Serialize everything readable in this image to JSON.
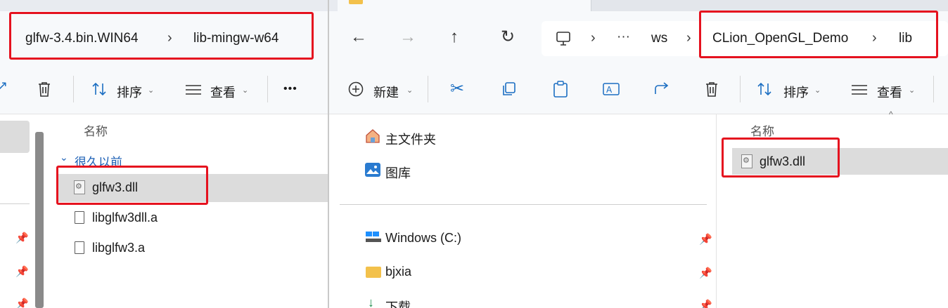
{
  "left": {
    "breadcrumb": [
      "glfw-3.4.bin.WIN64",
      "lib-mingw-w64"
    ],
    "toolbar": {
      "sort": "排序",
      "view": "查看",
      "more": "•••"
    },
    "header_name": "名称",
    "group_label": "很久以前",
    "files": [
      "glfw3.dll",
      "libglfw3dll.a",
      "libglfw3.a"
    ]
  },
  "right": {
    "breadcrumb": [
      "ws",
      "CLion_OpenGL_Demo",
      "lib"
    ],
    "ellipsis": "···",
    "toolbar": {
      "new": "新建",
      "sort": "排序",
      "view": "查看"
    },
    "nav": [
      "主文件夹",
      "图库",
      "Windows (C:)",
      "bjxia",
      "下载"
    ],
    "header_name": "名称",
    "files": [
      "glfw3.dll"
    ]
  }
}
